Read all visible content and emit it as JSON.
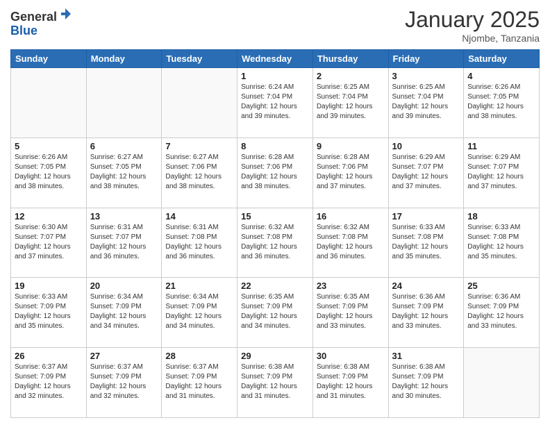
{
  "header": {
    "logo_general": "General",
    "logo_blue": "Blue",
    "month_title": "January 2025",
    "location": "Njombe, Tanzania"
  },
  "weekdays": [
    "Sunday",
    "Monday",
    "Tuesday",
    "Wednesday",
    "Thursday",
    "Friday",
    "Saturday"
  ],
  "weeks": [
    [
      {
        "day": "",
        "info": ""
      },
      {
        "day": "",
        "info": ""
      },
      {
        "day": "",
        "info": ""
      },
      {
        "day": "1",
        "info": "Sunrise: 6:24 AM\nSunset: 7:04 PM\nDaylight: 12 hours\nand 39 minutes."
      },
      {
        "day": "2",
        "info": "Sunrise: 6:25 AM\nSunset: 7:04 PM\nDaylight: 12 hours\nand 39 minutes."
      },
      {
        "day": "3",
        "info": "Sunrise: 6:25 AM\nSunset: 7:04 PM\nDaylight: 12 hours\nand 39 minutes."
      },
      {
        "day": "4",
        "info": "Sunrise: 6:26 AM\nSunset: 7:05 PM\nDaylight: 12 hours\nand 38 minutes."
      }
    ],
    [
      {
        "day": "5",
        "info": "Sunrise: 6:26 AM\nSunset: 7:05 PM\nDaylight: 12 hours\nand 38 minutes."
      },
      {
        "day": "6",
        "info": "Sunrise: 6:27 AM\nSunset: 7:05 PM\nDaylight: 12 hours\nand 38 minutes."
      },
      {
        "day": "7",
        "info": "Sunrise: 6:27 AM\nSunset: 7:06 PM\nDaylight: 12 hours\nand 38 minutes."
      },
      {
        "day": "8",
        "info": "Sunrise: 6:28 AM\nSunset: 7:06 PM\nDaylight: 12 hours\nand 38 minutes."
      },
      {
        "day": "9",
        "info": "Sunrise: 6:28 AM\nSunset: 7:06 PM\nDaylight: 12 hours\nand 37 minutes."
      },
      {
        "day": "10",
        "info": "Sunrise: 6:29 AM\nSunset: 7:07 PM\nDaylight: 12 hours\nand 37 minutes."
      },
      {
        "day": "11",
        "info": "Sunrise: 6:29 AM\nSunset: 7:07 PM\nDaylight: 12 hours\nand 37 minutes."
      }
    ],
    [
      {
        "day": "12",
        "info": "Sunrise: 6:30 AM\nSunset: 7:07 PM\nDaylight: 12 hours\nand 37 minutes."
      },
      {
        "day": "13",
        "info": "Sunrise: 6:31 AM\nSunset: 7:07 PM\nDaylight: 12 hours\nand 36 minutes."
      },
      {
        "day": "14",
        "info": "Sunrise: 6:31 AM\nSunset: 7:08 PM\nDaylight: 12 hours\nand 36 minutes."
      },
      {
        "day": "15",
        "info": "Sunrise: 6:32 AM\nSunset: 7:08 PM\nDaylight: 12 hours\nand 36 minutes."
      },
      {
        "day": "16",
        "info": "Sunrise: 6:32 AM\nSunset: 7:08 PM\nDaylight: 12 hours\nand 36 minutes."
      },
      {
        "day": "17",
        "info": "Sunrise: 6:33 AM\nSunset: 7:08 PM\nDaylight: 12 hours\nand 35 minutes."
      },
      {
        "day": "18",
        "info": "Sunrise: 6:33 AM\nSunset: 7:08 PM\nDaylight: 12 hours\nand 35 minutes."
      }
    ],
    [
      {
        "day": "19",
        "info": "Sunrise: 6:33 AM\nSunset: 7:09 PM\nDaylight: 12 hours\nand 35 minutes."
      },
      {
        "day": "20",
        "info": "Sunrise: 6:34 AM\nSunset: 7:09 PM\nDaylight: 12 hours\nand 34 minutes."
      },
      {
        "day": "21",
        "info": "Sunrise: 6:34 AM\nSunset: 7:09 PM\nDaylight: 12 hours\nand 34 minutes."
      },
      {
        "day": "22",
        "info": "Sunrise: 6:35 AM\nSunset: 7:09 PM\nDaylight: 12 hours\nand 34 minutes."
      },
      {
        "day": "23",
        "info": "Sunrise: 6:35 AM\nSunset: 7:09 PM\nDaylight: 12 hours\nand 33 minutes."
      },
      {
        "day": "24",
        "info": "Sunrise: 6:36 AM\nSunset: 7:09 PM\nDaylight: 12 hours\nand 33 minutes."
      },
      {
        "day": "25",
        "info": "Sunrise: 6:36 AM\nSunset: 7:09 PM\nDaylight: 12 hours\nand 33 minutes."
      }
    ],
    [
      {
        "day": "26",
        "info": "Sunrise: 6:37 AM\nSunset: 7:09 PM\nDaylight: 12 hours\nand 32 minutes."
      },
      {
        "day": "27",
        "info": "Sunrise: 6:37 AM\nSunset: 7:09 PM\nDaylight: 12 hours\nand 32 minutes."
      },
      {
        "day": "28",
        "info": "Sunrise: 6:37 AM\nSunset: 7:09 PM\nDaylight: 12 hours\nand 31 minutes."
      },
      {
        "day": "29",
        "info": "Sunrise: 6:38 AM\nSunset: 7:09 PM\nDaylight: 12 hours\nand 31 minutes."
      },
      {
        "day": "30",
        "info": "Sunrise: 6:38 AM\nSunset: 7:09 PM\nDaylight: 12 hours\nand 31 minutes."
      },
      {
        "day": "31",
        "info": "Sunrise: 6:38 AM\nSunset: 7:09 PM\nDaylight: 12 hours\nand 30 minutes."
      },
      {
        "day": "",
        "info": ""
      }
    ]
  ]
}
